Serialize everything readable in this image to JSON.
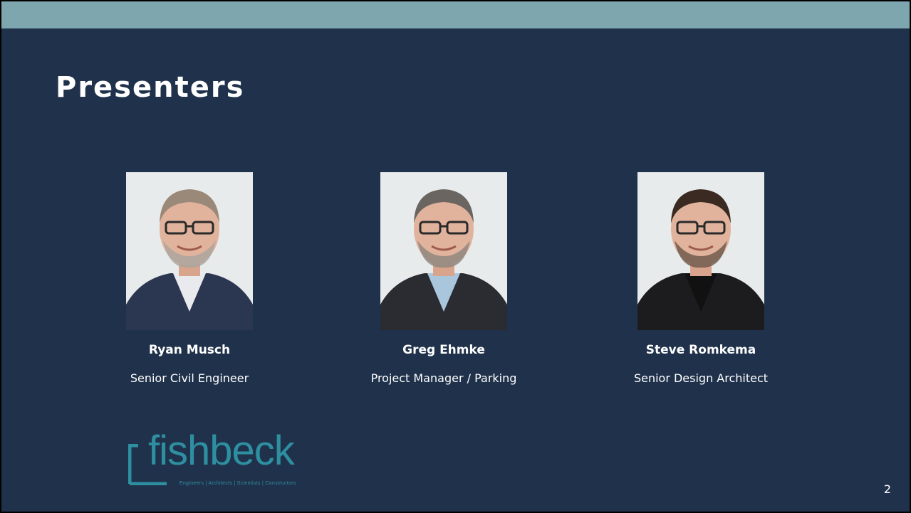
{
  "slide": {
    "title": "Presenters",
    "page_number": "2"
  },
  "presenters": [
    {
      "name": "Ryan Musch",
      "role": "Senior Civil Engineer",
      "suit_color": "#2b3650",
      "shirt_color": "#e9eaee",
      "hair_color": "#9a8878",
      "beard_color": "#a9a49d"
    },
    {
      "name": "Greg Ehmke",
      "role": "Project Manager / Parking",
      "suit_color": "#2a2c31",
      "shirt_color": "#a9c6dc",
      "hair_color": "#6a6560",
      "beard_color": "#8c857e"
    },
    {
      "name": "Steve Romkema",
      "role": "Senior Design Architect",
      "suit_color": "#1c1c1e",
      "shirt_color": "#111111",
      "hair_color": "#3a2a22",
      "beard_color": "#6a5548"
    }
  ],
  "logo": {
    "wordmark": "fishbeck",
    "tagline": "Engineers | Architects | Scientists | Constructors",
    "color": "#2e8fa0"
  },
  "colors": {
    "background": "#20324b",
    "top_band": "#7ea6ae",
    "text": "#ffffff"
  }
}
